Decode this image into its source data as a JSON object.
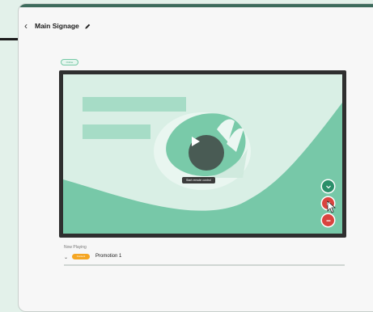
{
  "header": {
    "title": "Main Signage"
  },
  "device": {
    "status_badge": "Online"
  },
  "player": {
    "tooltip": "Start remote control"
  },
  "now_playing": {
    "label": "Now Playing",
    "schedule_badge": "Content",
    "name": "Promotion 1"
  },
  "icons": [
    "back-icon",
    "pencil-icon",
    "play-icon",
    "chevron-down-icon",
    "mouse-cursor-icon"
  ],
  "colors": {
    "accent": "#3d6b5c",
    "screen_bg": "#d9efe5",
    "shape_green": "#77c8a8",
    "green_button": "#2b8f6a",
    "red_button": "#d9443f",
    "badge_orange": "#f5a623"
  }
}
